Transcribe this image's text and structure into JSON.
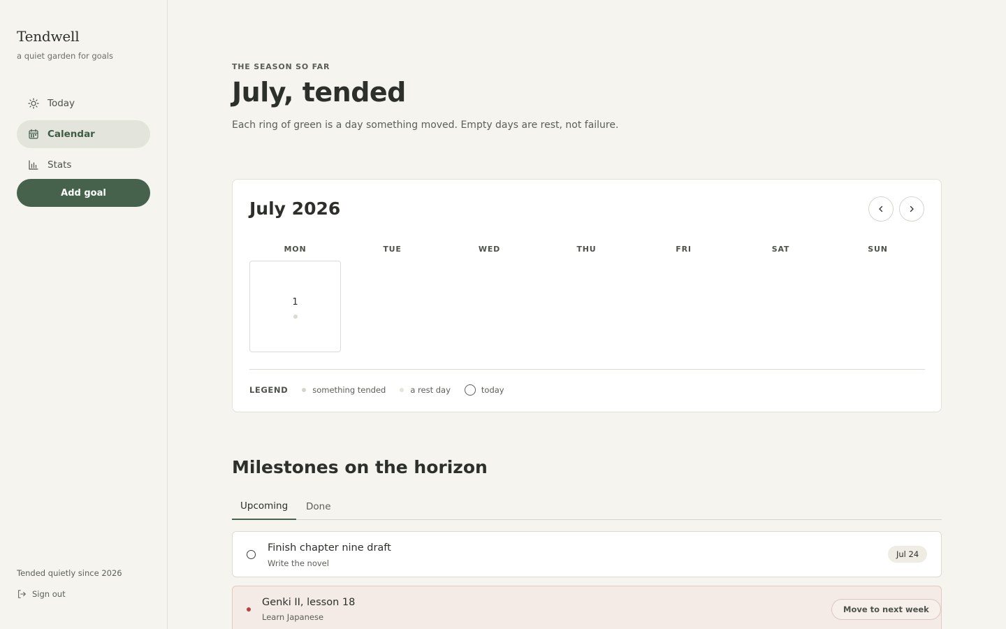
{
  "sidebar": {
    "brand": "Tendwell",
    "tagline": "a quiet garden for goals",
    "nav": [
      {
        "label": "Today",
        "icon": "sun-icon"
      },
      {
        "label": "Calendar",
        "icon": "calendar-icon",
        "active": true
      },
      {
        "label": "Stats",
        "icon": "bar-chart-icon"
      }
    ],
    "add_goal_label": "Add goal",
    "since": "Tended quietly since 2026",
    "sign_out": "Sign out"
  },
  "header": {
    "eyebrow": "THE SEASON SO FAR",
    "title": "July, tended",
    "subtitle": "Each ring of green is a day something moved. Empty days are rest, not failure."
  },
  "calendar": {
    "month": "July 2026",
    "weekdays": [
      "MON",
      "TUE",
      "WED",
      "THU",
      "FRI",
      "SAT",
      "SUN"
    ],
    "days": [
      {
        "number": "1"
      }
    ],
    "legend": {
      "label": "LEGEND",
      "tended": "something tended",
      "rest": "a rest day",
      "today": "today"
    }
  },
  "milestones": {
    "title": "Milestones on the horizon",
    "tabs": [
      {
        "label": "Upcoming",
        "active": true
      },
      {
        "label": "Done"
      }
    ],
    "items": [
      {
        "title": "Finish chapter nine draft",
        "goal": "Write the novel",
        "date": "Jul 24"
      },
      {
        "title": "Genki II, lesson 18",
        "goal": "Learn Japanese",
        "action": "Move to next week"
      }
    ]
  },
  "colors": {
    "accent": "#46624d",
    "background": "#f5f4ef",
    "overdue": "#b5453a"
  }
}
